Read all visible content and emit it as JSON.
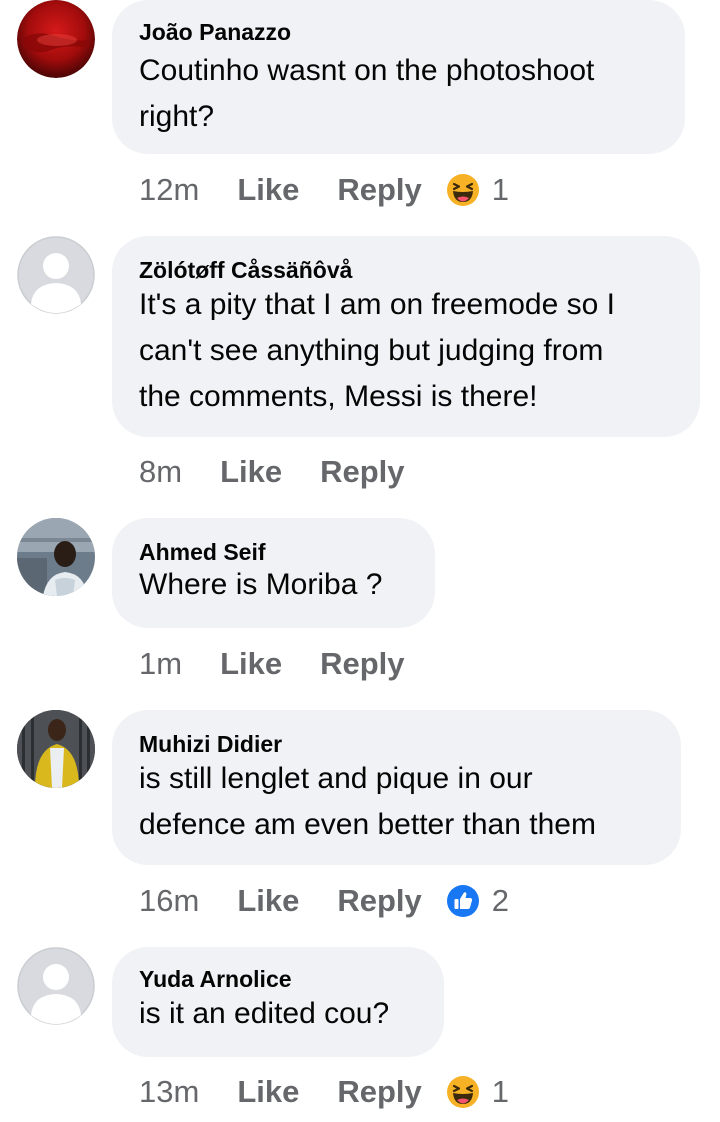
{
  "comments": [
    {
      "author": "João Panazzo",
      "lines": [
        "Coutinho wasnt on the photoshoot",
        "right?"
      ],
      "time": "12m",
      "like_label": "Like",
      "reply_label": "Reply",
      "reaction": {
        "icon": "haha-emoji-icon",
        "count": "1"
      },
      "avatar": "red-photo"
    },
    {
      "author": "Zölótøff Cåssäñôvå",
      "lines": [
        "It's a pity that I am on freemode so I",
        "can't see anything but judging from",
        "the comments, Messi is there!"
      ],
      "time": "8m",
      "like_label": "Like",
      "reply_label": "Reply",
      "avatar": "default-silhouette"
    },
    {
      "author": "Ahmed Seif",
      "lines": [
        "Where is Moriba ?"
      ],
      "time": "1m",
      "like_label": "Like",
      "reply_label": "Reply",
      "avatar": "person-photo"
    },
    {
      "author": "Muhizi Didier",
      "lines": [
        "is still lenglet and pique in our",
        "defence am even better than them"
      ],
      "time": "16m",
      "like_label": "Like",
      "reply_label": "Reply",
      "reaction": {
        "icon": "thumbs-up-icon",
        "count": "2"
      },
      "avatar": "person-yellow-jacket-photo"
    },
    {
      "author": "Yuda Arnolice",
      "lines": [
        "is it an edited cou?"
      ],
      "time": "13m",
      "like_label": "Like",
      "reply_label": "Reply",
      "reaction": {
        "icon": "haha-emoji-icon",
        "count": "1"
      },
      "avatar": "default-silhouette"
    }
  ],
  "colors": {
    "bubble": "#f0f2f5",
    "meta_text": "#65676b",
    "text": "#050505",
    "like_blue": "#1877f2",
    "haha_yellow": "#f7b125"
  }
}
